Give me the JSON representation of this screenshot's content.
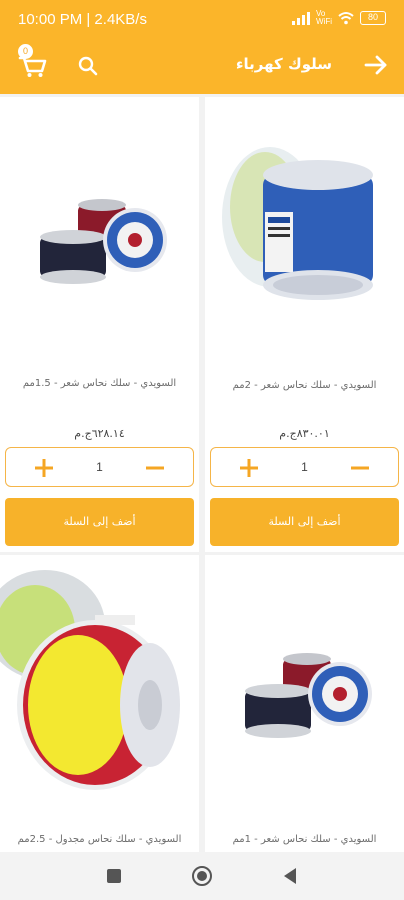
{
  "status_bar": {
    "time": "10:00 PM | 2.4KB/s",
    "volte": "Vo\nWiFi",
    "battery": "80"
  },
  "app_bar": {
    "title": "سلوك كهرباء",
    "cart_count": "0",
    "accent_color": "#fbb52a"
  },
  "products": [
    {
      "name": "السويدي - سلك نحاس شعر - 2مم",
      "price": "٨٣٠.٠١ج.م",
      "quantity": "1",
      "add_label": "أضف إلى السلة",
      "image": "blue-cable-spool"
    },
    {
      "name": "السويدي - سلك نحاس شعر - 1.5مم",
      "price": "٦٢٨.١٤ج.م",
      "quantity": "1",
      "add_label": "أضف إلى السلة",
      "image": "red-black-cable-spools"
    },
    {
      "name": "السويدي - سلك نحاس شعر - 1مم",
      "image": "red-black-cable-spools"
    },
    {
      "name": "السويدي - سلك نحاس مجدول - 2.5مم",
      "image": "yellow-cable-spool"
    }
  ]
}
